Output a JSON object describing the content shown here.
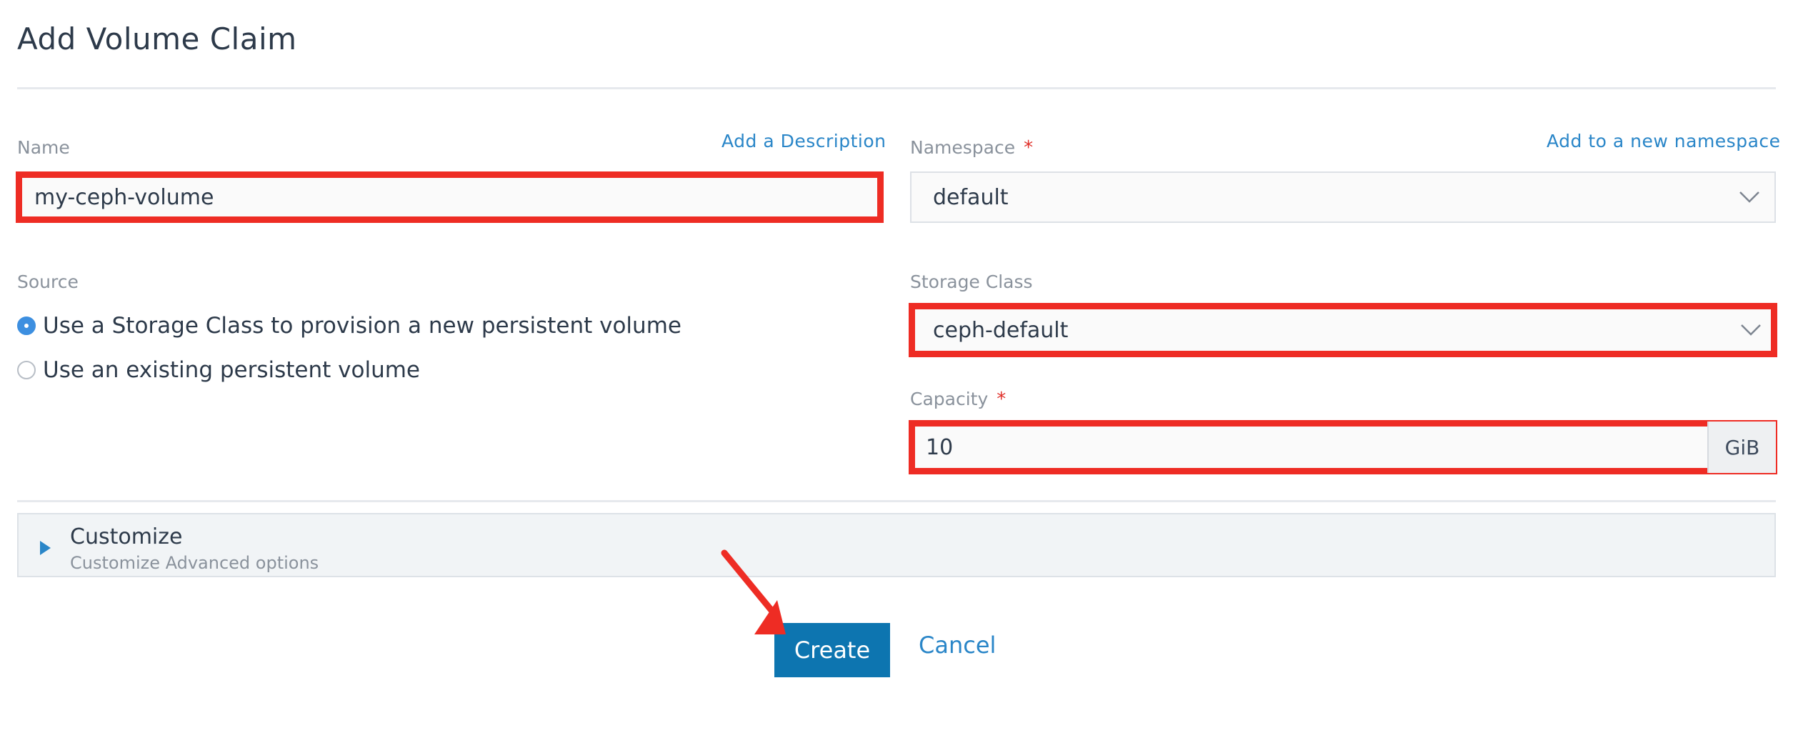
{
  "page": {
    "title": "Add Volume Claim"
  },
  "name_field": {
    "label": "Name",
    "value": "my-ceph-volume",
    "add_description_link": "Add a Description"
  },
  "namespace_field": {
    "label": "Namespace",
    "required_mark": "*",
    "value": "default",
    "add_namespace_link": "Add to a new namespace"
  },
  "source": {
    "label": "Source",
    "options": [
      {
        "label": "Use a Storage Class to provision a new persistent volume",
        "selected": true
      },
      {
        "label": "Use an existing persistent volume",
        "selected": false
      }
    ]
  },
  "storage_class_field": {
    "label": "Storage Class",
    "value": "ceph-default"
  },
  "capacity_field": {
    "label": "Capacity",
    "required_mark": "*",
    "value": "10",
    "unit": "GiB"
  },
  "customize": {
    "title": "Customize",
    "subtitle": "Customize Advanced options"
  },
  "actions": {
    "create_label": "Create",
    "cancel_label": "Cancel"
  },
  "colors": {
    "highlight": "#ee2c24",
    "primary": "#0d75b0",
    "link": "#2a86c8"
  }
}
